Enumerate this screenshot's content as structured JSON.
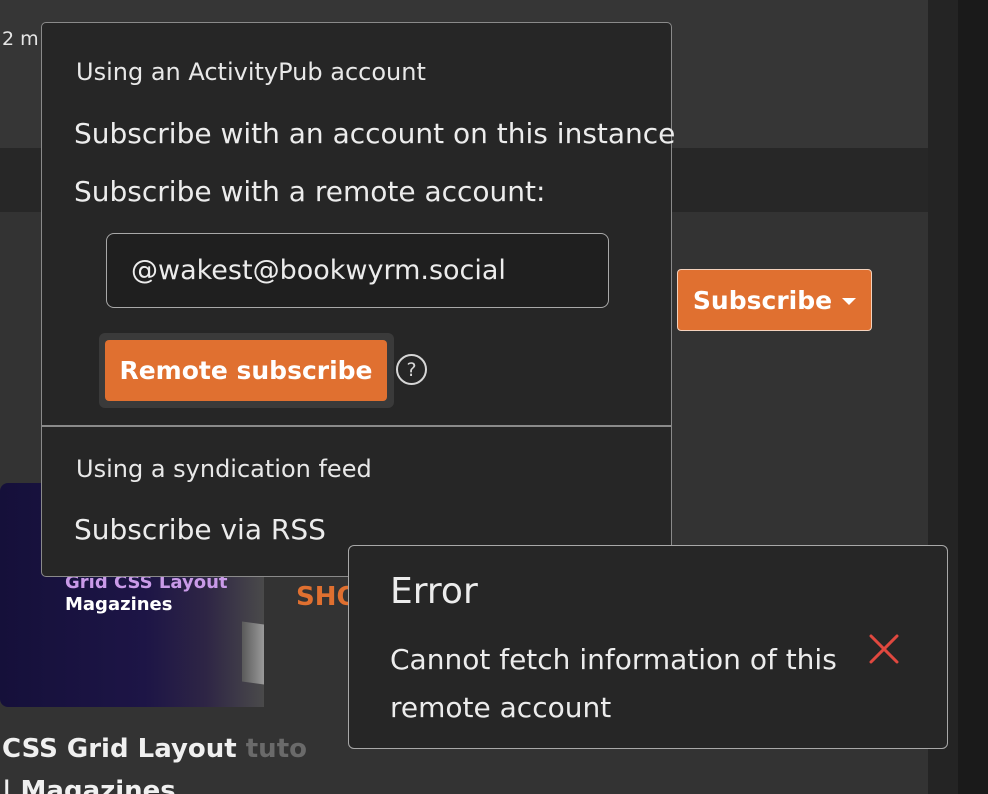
{
  "background": {
    "top_card": {
      "meta": "2 m",
      "title_fragment": ""
    },
    "subscribe_button": {
      "label": "Subscribe"
    },
    "thumbnail": {
      "line1": "Grid CSS Layout",
      "line2": "Magazines"
    },
    "show_fragment": "SHO",
    "article": {
      "title_visible": "CSS Grid Layout ",
      "title_faded": "tuto",
      "subtitle": "| Magazines"
    }
  },
  "dropdown": {
    "activitypub_heading": "Using an ActivityPub account",
    "subscribe_local": "Subscribe with an account on this instance",
    "subscribe_remote_label": "Subscribe with a remote account:",
    "remote_account_value": "@wakest@bookwyrm.social",
    "remote_subscribe_button": "Remote subscribe",
    "help_icon": "question-circle-icon",
    "syndication_heading": "Using a syndication feed",
    "subscribe_rss": "Subscribe via RSS"
  },
  "toast": {
    "title": "Error",
    "message": "Cannot fetch information of this remote account",
    "close_icon": "close-icon"
  },
  "colors": {
    "accent": "#e07030",
    "error_x": "#e0483f",
    "panel": "#262626",
    "page": "#323232"
  }
}
